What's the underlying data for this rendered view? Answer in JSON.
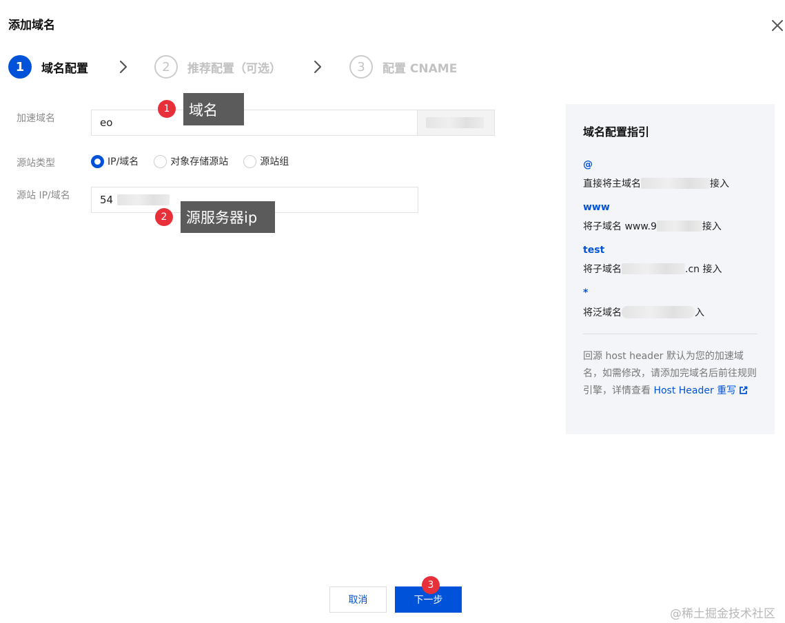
{
  "dialog": {
    "title": "添加域名"
  },
  "steps": [
    {
      "number": "1",
      "label": "域名配置",
      "state": "active"
    },
    {
      "number": "2",
      "label": "推荐配置（可选）",
      "state": "inactive"
    },
    {
      "number": "3",
      "label": "配置 CNAME",
      "state": "inactive"
    }
  ],
  "form": {
    "domain": {
      "label": "加速域名",
      "value": "eo"
    },
    "origin_type": {
      "label": "源站类型",
      "options": [
        "IP/域名",
        "对象存储源站",
        "源站组"
      ],
      "selected": "IP/域名"
    },
    "origin": {
      "label": "源站 IP/域名",
      "value": "54"
    }
  },
  "annotations": [
    {
      "badge": "1",
      "text": "域名"
    },
    {
      "badge": "2",
      "text": "源服务器ip"
    },
    {
      "badge": "3"
    }
  ],
  "guide": {
    "title": "域名配置指引",
    "items": [
      {
        "key": "@",
        "desc_before": "直接将主域名",
        "desc_after": "接入"
      },
      {
        "key": "www",
        "desc_before": "将子域名 www.9",
        "desc_after": "接入"
      },
      {
        "key": "test",
        "desc_before": "将子域名",
        "desc_after": ".cn 接入"
      },
      {
        "key": "*",
        "desc_before": "将泛域名",
        "desc_after": "入"
      }
    ],
    "note_text": "回源 host header 默认为您的加速域名，如需修改，请添加完域名后前往规则引擎，详情查看 ",
    "note_link": "Host Header 重写"
  },
  "footer": {
    "cancel_label": "取消",
    "next_label": "下一步"
  },
  "watermark": "@稀土掘金技术社区",
  "colors": {
    "primary": "#0052d9",
    "annotation_badge": "#e8303a",
    "annotation_box": "#5b5b5b",
    "guide_bg": "#f3f5f8"
  }
}
